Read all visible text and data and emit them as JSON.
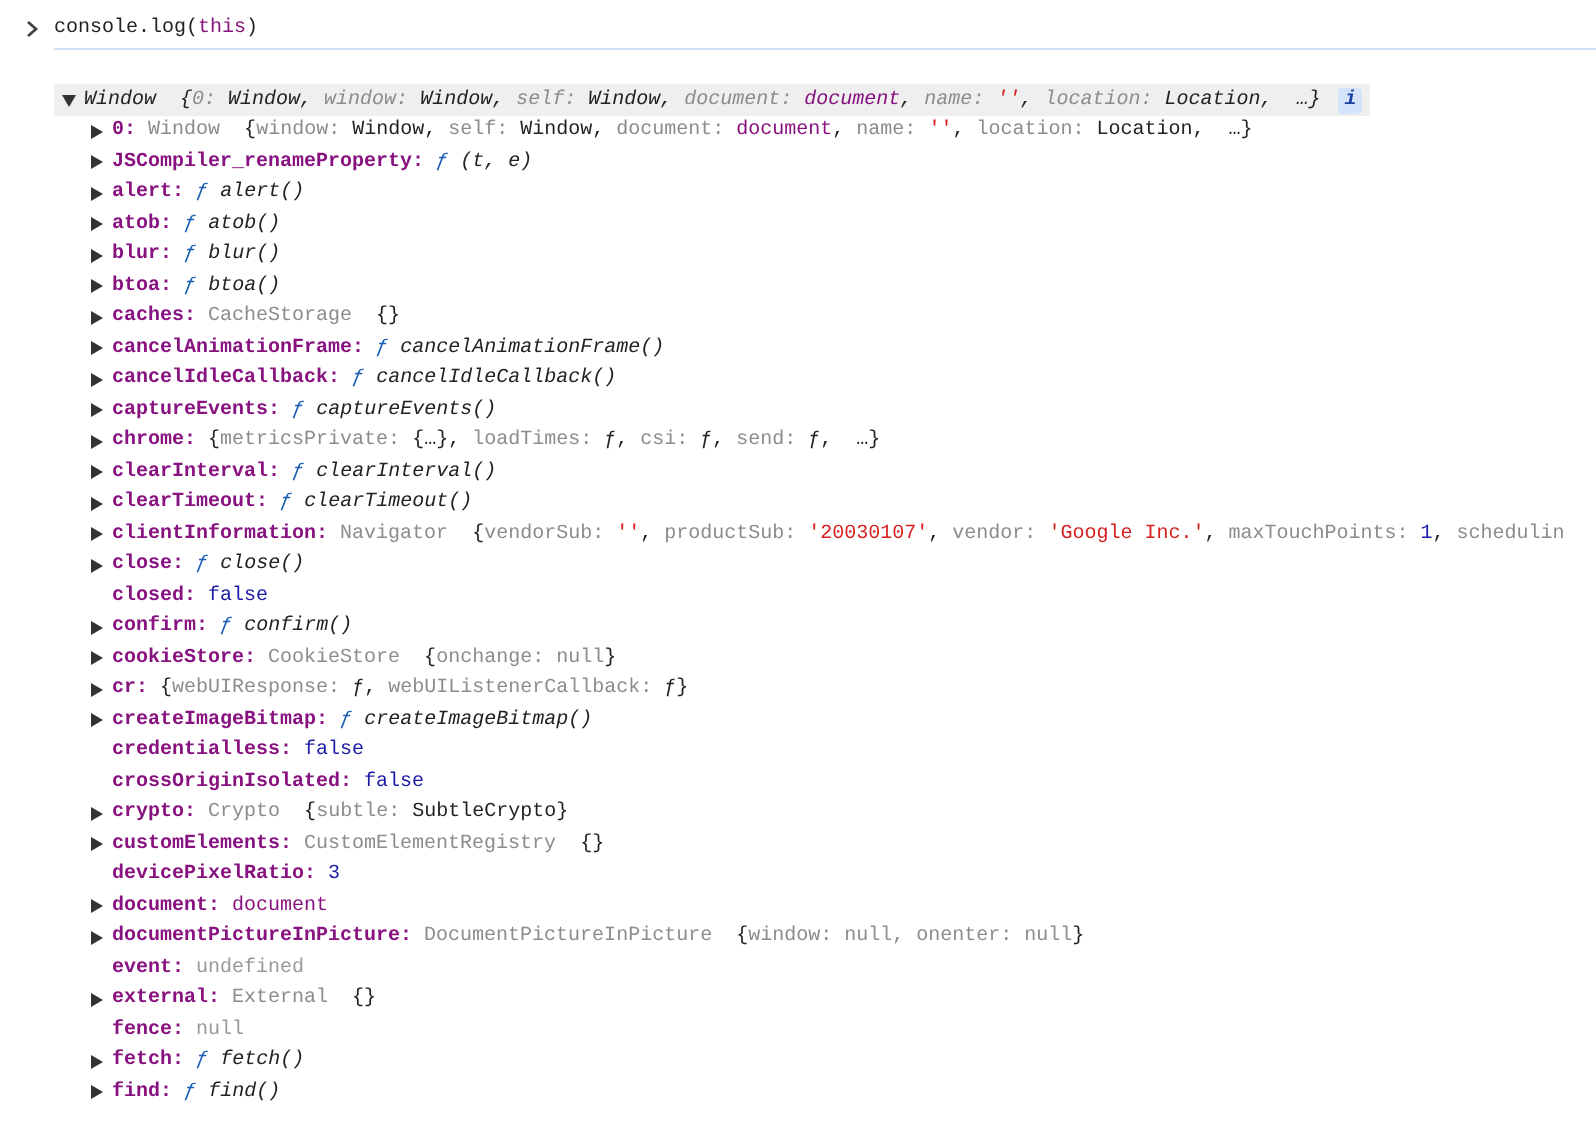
{
  "prompt": {
    "tokens": [
      {
        "kind": "plain",
        "text": "console.log("
      },
      {
        "kind": "keyword",
        "text": "this"
      },
      {
        "kind": "plain",
        "text": ")"
      }
    ]
  },
  "object": {
    "expanded": true,
    "selected": true,
    "info_badge": "i",
    "summary": [
      {
        "kind": "plain",
        "text": "Window  {"
      },
      {
        "kind": "key",
        "text": "0:"
      },
      {
        "kind": "plain",
        "text": " Window, "
      },
      {
        "kind": "key",
        "text": "window:"
      },
      {
        "kind": "plain",
        "text": " Window, "
      },
      {
        "kind": "key",
        "text": "self:"
      },
      {
        "kind": "plain",
        "text": " Window, "
      },
      {
        "kind": "key",
        "text": "document: "
      },
      {
        "kind": "ref",
        "text": "document"
      },
      {
        "kind": "plain",
        "text": ", "
      },
      {
        "kind": "key",
        "text": "name: "
      },
      {
        "kind": "strc",
        "text": "'', "
      },
      {
        "kind": "key",
        "text": "location:"
      },
      {
        "kind": "plain",
        "text": " Location,  …}"
      }
    ],
    "properties": [
      {
        "name": "0:",
        "expandable": true,
        "expanded": false,
        "value": [
          {
            "kind": "type",
            "text": "Window"
          },
          {
            "kind": "plain",
            "text": "  {"
          },
          {
            "kind": "key",
            "text": "window:"
          },
          {
            "kind": "plain",
            "text": " Window, "
          },
          {
            "kind": "key",
            "text": "self:"
          },
          {
            "kind": "plain",
            "text": " Window, "
          },
          {
            "kind": "key",
            "text": "document: "
          },
          {
            "kind": "ref",
            "text": "document"
          },
          {
            "kind": "plain",
            "text": ", "
          },
          {
            "kind": "key",
            "text": "name: "
          },
          {
            "kind": "strc",
            "text": "'', "
          },
          {
            "kind": "key",
            "text": "location:"
          },
          {
            "kind": "plain",
            "text": " Location,  …}"
          }
        ]
      },
      {
        "name": "JSCompiler_renameProperty:",
        "expandable": true,
        "expanded": false,
        "value": [
          {
            "kind": "func",
            "text": "ƒ"
          },
          {
            "kind": "sig",
            "text": "(t, e)"
          }
        ]
      },
      {
        "name": "alert:",
        "expandable": true,
        "expanded": false,
        "value": [
          {
            "kind": "func",
            "text": "ƒ"
          },
          {
            "kind": "sig",
            "text": "alert()"
          }
        ]
      },
      {
        "name": "atob:",
        "expandable": true,
        "expanded": false,
        "value": [
          {
            "kind": "func",
            "text": "ƒ"
          },
          {
            "kind": "sig",
            "text": "atob()"
          }
        ]
      },
      {
        "name": "blur:",
        "expandable": true,
        "expanded": false,
        "value": [
          {
            "kind": "func",
            "text": "ƒ"
          },
          {
            "kind": "sig",
            "text": "blur()"
          }
        ]
      },
      {
        "name": "btoa:",
        "expandable": true,
        "expanded": false,
        "value": [
          {
            "kind": "func",
            "text": "ƒ"
          },
          {
            "kind": "sig",
            "text": "btoa()"
          }
        ]
      },
      {
        "name": "caches:",
        "expandable": true,
        "expanded": false,
        "value": [
          {
            "kind": "type",
            "text": "CacheStorage"
          },
          {
            "kind": "plain",
            "text": "  {}"
          }
        ]
      },
      {
        "name": "cancelAnimationFrame:",
        "expandable": true,
        "expanded": false,
        "value": [
          {
            "kind": "func",
            "text": "ƒ"
          },
          {
            "kind": "sig",
            "text": "cancelAnimationFrame()"
          }
        ]
      },
      {
        "name": "cancelIdleCallback:",
        "expandable": true,
        "expanded": false,
        "value": [
          {
            "kind": "func",
            "text": "ƒ"
          },
          {
            "kind": "sig",
            "text": "cancelIdleCallback()"
          }
        ]
      },
      {
        "name": "captureEvents:",
        "expandable": true,
        "expanded": false,
        "value": [
          {
            "kind": "func",
            "text": "ƒ"
          },
          {
            "kind": "sig",
            "text": "captureEvents()"
          }
        ]
      },
      {
        "name": "chrome:",
        "expandable": true,
        "expanded": false,
        "value": [
          {
            "kind": "plain",
            "text": "{"
          },
          {
            "kind": "key",
            "text": "metricsPrivate:"
          },
          {
            "kind": "plain",
            "text": " {…}, "
          },
          {
            "kind": "key",
            "text": "loadTimes:"
          },
          {
            "kind": "plain",
            "text": " ƒ, "
          },
          {
            "kind": "key",
            "text": "csi:"
          },
          {
            "kind": "plain",
            "text": " ƒ, "
          },
          {
            "kind": "key",
            "text": "send:"
          },
          {
            "kind": "plain",
            "text": " ƒ,  …}"
          }
        ]
      },
      {
        "name": "clearInterval:",
        "expandable": true,
        "expanded": false,
        "value": [
          {
            "kind": "func",
            "text": "ƒ"
          },
          {
            "kind": "sig",
            "text": "clearInterval()"
          }
        ]
      },
      {
        "name": "clearTimeout:",
        "expandable": true,
        "expanded": false,
        "value": [
          {
            "kind": "func",
            "text": "ƒ"
          },
          {
            "kind": "sig",
            "text": "clearTimeout()"
          }
        ]
      },
      {
        "name": "clientInformation:",
        "expandable": true,
        "expanded": false,
        "value": [
          {
            "kind": "type",
            "text": "Navigator"
          },
          {
            "kind": "plain",
            "text": "  {"
          },
          {
            "kind": "key",
            "text": "vendorSub: "
          },
          {
            "kind": "strc",
            "text": "'', "
          },
          {
            "kind": "key",
            "text": "productSub: "
          },
          {
            "kind": "str",
            "text": "'20030107'"
          },
          {
            "kind": "plain",
            "text": ", "
          },
          {
            "kind": "key",
            "text": "vendor: "
          },
          {
            "kind": "str",
            "text": "'Google Inc.'"
          },
          {
            "kind": "plain",
            "text": ", "
          },
          {
            "kind": "key",
            "text": "maxTouchPoints: "
          },
          {
            "kind": "num",
            "text": "1"
          },
          {
            "kind": "plain",
            "text": ", "
          },
          {
            "kind": "key",
            "text": "schedulin"
          }
        ]
      },
      {
        "name": "close:",
        "expandable": true,
        "expanded": false,
        "value": [
          {
            "kind": "func",
            "text": "ƒ"
          },
          {
            "kind": "sig",
            "text": "close()"
          }
        ]
      },
      {
        "name": "closed:",
        "expandable": false,
        "value": [
          {
            "kind": "num",
            "text": "false"
          }
        ]
      },
      {
        "name": "confirm:",
        "expandable": true,
        "expanded": false,
        "value": [
          {
            "kind": "func",
            "text": "ƒ"
          },
          {
            "kind": "sig",
            "text": "confirm()"
          }
        ]
      },
      {
        "name": "cookieStore:",
        "expandable": true,
        "expanded": false,
        "value": [
          {
            "kind": "type",
            "text": "CookieStore"
          },
          {
            "kind": "plain",
            "text": "  {"
          },
          {
            "kind": "key",
            "text": "onchange: null"
          },
          {
            "kind": "plain",
            "text": "}"
          }
        ]
      },
      {
        "name": "cr:",
        "expandable": true,
        "expanded": false,
        "value": [
          {
            "kind": "plain",
            "text": "{"
          },
          {
            "kind": "key",
            "text": "webUIResponse:"
          },
          {
            "kind": "plain",
            "text": " ƒ, "
          },
          {
            "kind": "key",
            "text": "webUIListenerCallback:"
          },
          {
            "kind": "plain",
            "text": " ƒ}"
          }
        ]
      },
      {
        "name": "createImageBitmap:",
        "expandable": true,
        "expanded": false,
        "value": [
          {
            "kind": "func",
            "text": "ƒ"
          },
          {
            "kind": "sig",
            "text": "createImageBitmap()"
          }
        ]
      },
      {
        "name": "credentialless:",
        "expandable": false,
        "value": [
          {
            "kind": "num",
            "text": "false"
          }
        ]
      },
      {
        "name": "crossOriginIsolated:",
        "expandable": false,
        "value": [
          {
            "kind": "num",
            "text": "false"
          }
        ]
      },
      {
        "name": "crypto:",
        "expandable": true,
        "expanded": false,
        "value": [
          {
            "kind": "type",
            "text": "Crypto"
          },
          {
            "kind": "plain",
            "text": "  {"
          },
          {
            "kind": "key",
            "text": "subtle:"
          },
          {
            "kind": "plain",
            "text": " SubtleCrypto}"
          }
        ]
      },
      {
        "name": "customElements:",
        "expandable": true,
        "expanded": false,
        "value": [
          {
            "kind": "type",
            "text": "CustomElementRegistry"
          },
          {
            "kind": "plain",
            "text": "  {}"
          }
        ]
      },
      {
        "name": "devicePixelRatio:",
        "expandable": false,
        "value": [
          {
            "kind": "num",
            "text": "3"
          }
        ]
      },
      {
        "name": "document:",
        "expandable": true,
        "expanded": false,
        "value": [
          {
            "kind": "ref",
            "text": "document"
          }
        ]
      },
      {
        "name": "documentPictureInPicture:",
        "expandable": true,
        "expanded": false,
        "value": [
          {
            "kind": "type",
            "text": "DocumentPictureInPicture"
          },
          {
            "kind": "plain",
            "text": "  {"
          },
          {
            "kind": "key",
            "text": "window: null, onenter: null"
          },
          {
            "kind": "plain",
            "text": "}"
          }
        ]
      },
      {
        "name": "event:",
        "expandable": false,
        "value": [
          {
            "kind": "muted",
            "text": "undefined"
          }
        ]
      },
      {
        "name": "external:",
        "expandable": true,
        "expanded": false,
        "value": [
          {
            "kind": "type",
            "text": "External"
          },
          {
            "kind": "plain",
            "text": "  {}"
          }
        ]
      },
      {
        "name": "fence:",
        "expandable": false,
        "value": [
          {
            "kind": "muted",
            "text": "null"
          }
        ]
      },
      {
        "name": "fetch:",
        "expandable": true,
        "expanded": false,
        "value": [
          {
            "kind": "func",
            "text": "ƒ"
          },
          {
            "kind": "sig",
            "text": "fetch()"
          }
        ]
      },
      {
        "name": "find:",
        "expandable": true,
        "expanded": false,
        "value": [
          {
            "kind": "func",
            "text": "ƒ"
          },
          {
            "kind": "sig",
            "text": "find()"
          }
        ]
      }
    ]
  }
}
